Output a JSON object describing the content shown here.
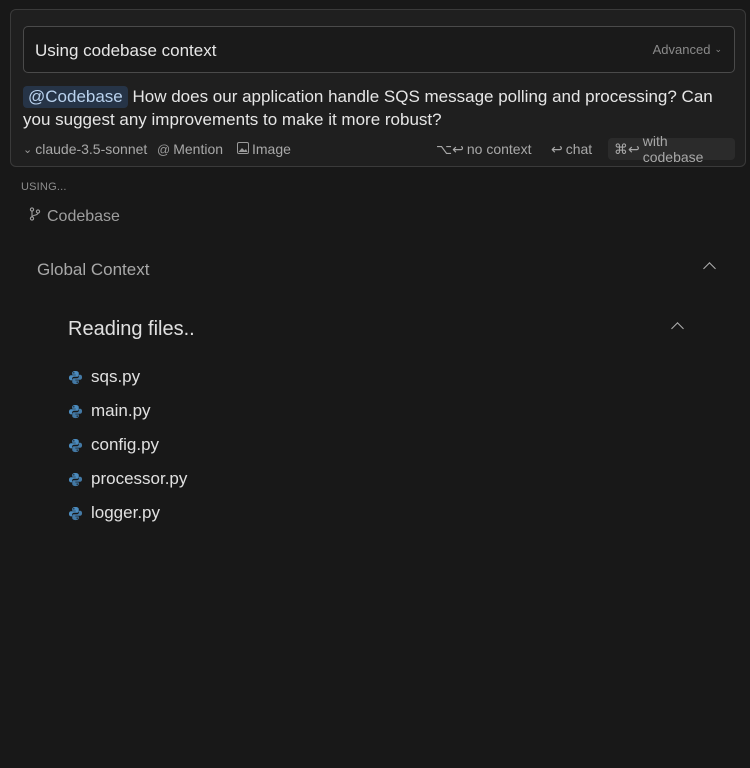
{
  "composer": {
    "input_value": "Using codebase context",
    "advanced_label": "Advanced",
    "mention": "@Codebase",
    "query_text": " How does our application handle SQS message polling and processing? Can you suggest any improvements to make it more robust?",
    "toolbar": {
      "model": "claude-3.5-sonnet",
      "mention_label": "Mention",
      "image_label": "Image",
      "no_context_shortcut": "⌥↩",
      "no_context_label": "no context",
      "chat_shortcut": "↩",
      "chat_label": "chat",
      "codebase_shortcut": "⌘↩",
      "codebase_label": "with codebase"
    }
  },
  "context": {
    "using_label": "USING...",
    "codebase_label": "Codebase",
    "global_context_label": "Global Context",
    "reading_title": "Reading files..",
    "files": [
      "sqs.py",
      "main.py",
      "config.py",
      "processor.py",
      "logger.py"
    ]
  },
  "colors": {
    "background": "#181818",
    "mention_chip": "#263447",
    "python_blue": "#4b8bbe",
    "python_yellow": "#ffd43b"
  }
}
